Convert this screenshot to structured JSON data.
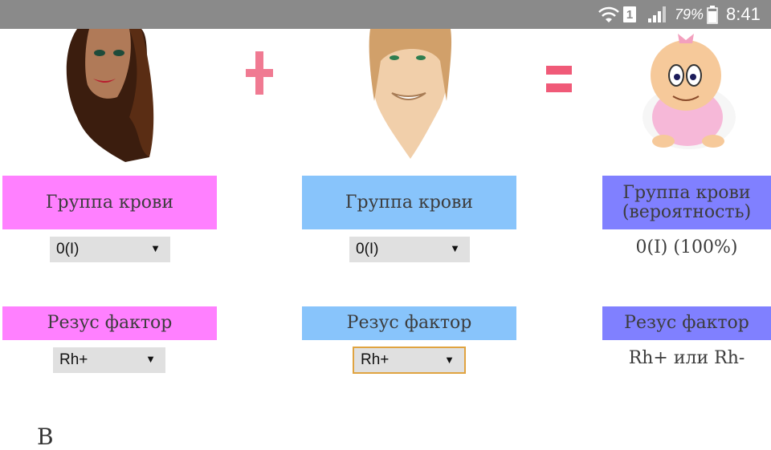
{
  "status_bar": {
    "wifi_icon": "wifi-icon",
    "sim_label": "1",
    "signal_icon": "signal-icon",
    "battery_percent": "79%",
    "battery_icon": "battery-icon",
    "time": "8:41"
  },
  "images": {
    "mother": "woman-avatar",
    "plus": "plus-sign",
    "father": "man-avatar",
    "equals": "equals-sign",
    "child": "baby-avatar"
  },
  "mother": {
    "blood_group_header": "Группа крови",
    "blood_group_value": "0(I)",
    "rh_header": "Резус фактор",
    "rh_value": "Rh+"
  },
  "father": {
    "blood_group_header": "Группа крови",
    "blood_group_value": "0(I)",
    "rh_header": "Резус фактор",
    "rh_value": "Rh+"
  },
  "child": {
    "blood_group_header_line1": "Группа крови",
    "blood_group_header_line2": "(вероятность)",
    "blood_group_result": "0(I) (100%)",
    "rh_header": "Резус фактор",
    "rh_result": "Rh+ или Rh-"
  },
  "bottom_text": "В"
}
